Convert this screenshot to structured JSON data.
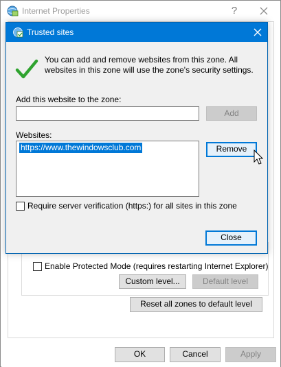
{
  "parent_window": {
    "title": "Internet Properties",
    "help_label": "?",
    "protected_mode": {
      "label": "Enable Protected Mode (requires restarting Internet Explorer)",
      "checked": false
    },
    "custom_level_label": "Custom level...",
    "default_level_label": "Default level",
    "reset_all_label": "Reset all zones to default level",
    "ok_label": "OK",
    "cancel_label": "Cancel",
    "apply_label": "Apply"
  },
  "dialog": {
    "title": "Trusted sites",
    "info_text": "You can add and remove websites from this zone. All websites in this zone will use the zone's security settings.",
    "add_label": "Add this website to the zone:",
    "add_input_value": "",
    "add_button_label": "Add",
    "websites_label": "Websites:",
    "websites": [
      "https://www.thewindowsclub.com"
    ],
    "remove_button_label": "Remove",
    "require_verification": {
      "label": "Require server verification (https:) for all sites in this zone",
      "checked": false
    },
    "close_button_label": "Close"
  },
  "colors": {
    "accent": "#0078d7",
    "check_green": "#2fa32f",
    "disabled_text": "#838383"
  },
  "icons": [
    "internet-properties-icon",
    "help-icon",
    "close-icon",
    "trusted-sites-icon",
    "checkmark-icon",
    "mouse-cursor-icon"
  ]
}
